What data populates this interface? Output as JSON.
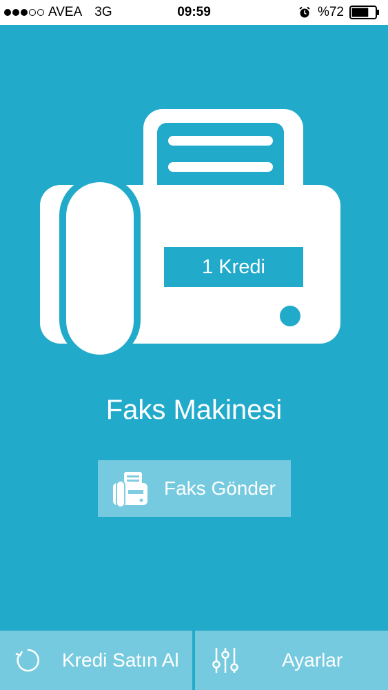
{
  "status_bar": {
    "signal_strength": 3,
    "signal_max": 5,
    "carrier": "AVEA",
    "network": "3G",
    "time": "09:59",
    "battery": "%72",
    "battery_level": 0.72,
    "icons": [
      "signal-dots-icon",
      "alarm-clock-icon",
      "battery-icon"
    ]
  },
  "fax": {
    "credit_label": "1 Kredi",
    "title": "Faks Makinesi",
    "icon": "fax-machine-icon"
  },
  "actions": {
    "send_label": "Faks Gönder",
    "send_icon": "fax-icon"
  },
  "bottom_bar": {
    "buy_label": "Kredi Satın Al",
    "buy_icon": "refresh-icon",
    "settings_label": "Ayarlar",
    "settings_icon": "sliders-icon"
  },
  "colors": {
    "background": "#22aacb",
    "foreground": "#ffffff"
  }
}
